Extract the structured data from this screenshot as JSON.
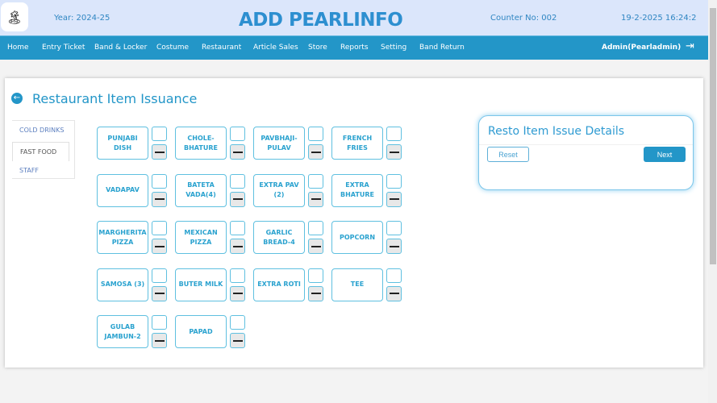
{
  "header": {
    "year": "Year: 2024-25",
    "title": "ADD PEARLINFO",
    "counter": "Counter No: 002",
    "datetime": "19-2-2025 16:24:2"
  },
  "nav": {
    "items": [
      "Home",
      "Entry Ticket",
      "Band & Locker",
      "Costume",
      "Restaurant",
      "Article Sales",
      "Store",
      "Reports",
      "Setting",
      "Band Return"
    ],
    "user": "Admin(Pearladmin)"
  },
  "page": {
    "title": "Restaurant Item Issuance"
  },
  "tabs": [
    "COLD DRINKS",
    "FAST FOOD",
    "STAFF"
  ],
  "active_tab": "FAST FOOD",
  "items": [
    "PUNJABI DISH",
    "CHOLE-BHATURE",
    "PAVBHAJI-PULAV",
    "FRENCH FRIES",
    "VADAPAV",
    "BATETA VADA(4)",
    "EXTRA PAV (2)",
    "EXTRA BHATURE",
    "MARGHERITA PIZZA",
    "MEXICAN PIZZA",
    "GARLIC BREAD-4",
    "POPCORN",
    "SAMOSA (3)",
    "BUTER MILK",
    "EXTRA ROTI",
    "TEE",
    "GULAB JAMBUN-2",
    "PAPAD"
  ],
  "panel": {
    "title": "Resto Item Issue Details",
    "reset": "Reset",
    "next": "Next"
  }
}
